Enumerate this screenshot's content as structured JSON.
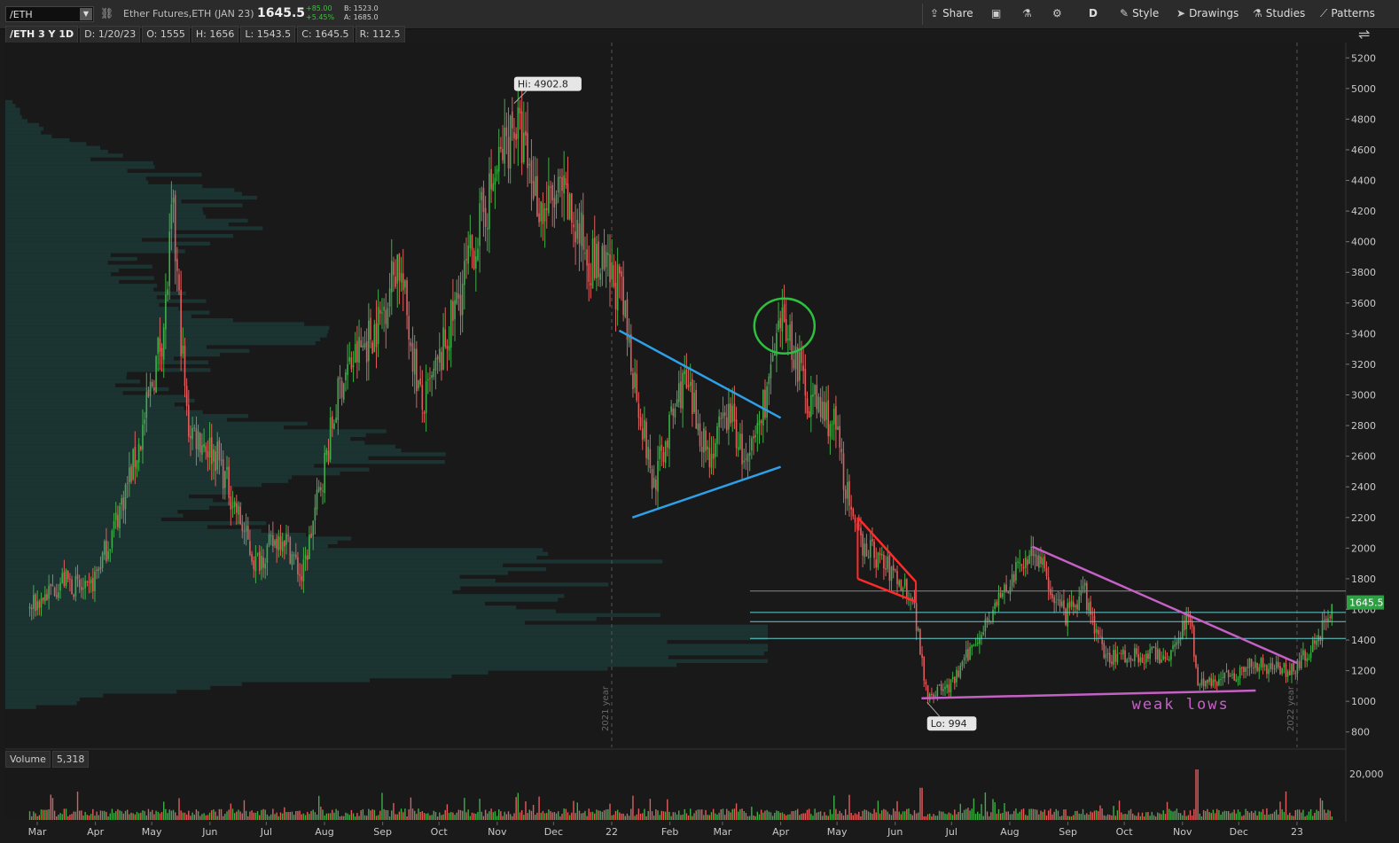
{
  "header": {
    "symbol": "/ETH",
    "description": "Ether Futures,ETH (JAN 23)",
    "last": "1645.5",
    "net_change": "+85.00",
    "pct_change": "+5.45%",
    "bid": "B: 1523.0",
    "ask": "A: 1685.0",
    "timeframe": "D",
    "toolbar": {
      "share": "Share",
      "style": "Style",
      "drawings": "Drawings",
      "studies": "Studies",
      "patterns": "Patterns"
    }
  },
  "info_bar": {
    "label": "/ETH 3 Y 1D",
    "date": "D: 1/20/23",
    "open": "O: 1555",
    "high": "H: 1656",
    "low": "L: 1543.5",
    "close": "C: 1645.5",
    "range": "R: 112.5"
  },
  "volume_panel": {
    "label": "Volume",
    "value": "5,318",
    "tick": "20,000"
  },
  "colors": {
    "up": "#3fae49",
    "down": "#e05d5d",
    "background": "#1a1a1a",
    "blue_trend": "#2ea0e8",
    "red_channel": "#ff2a2a",
    "magenta": "#c561c5",
    "green_circle": "#2fbf3f",
    "cyan_level": "#5fd0d0",
    "volume_profile": "#1c3a37"
  },
  "chart_data": {
    "type": "candlestick",
    "symbol": "/ETH",
    "ylim": [
      700,
      5300
    ],
    "y_ticks": [
      800,
      1000,
      1200,
      1400,
      1600,
      1800,
      2000,
      2200,
      2400,
      2600,
      2800,
      3000,
      3200,
      3400,
      3600,
      3800,
      4000,
      4200,
      4400,
      4600,
      4800,
      5000,
      5200
    ],
    "x_labels": [
      "Mar",
      "Apr",
      "May",
      "Jun",
      "Jul",
      "Aug",
      "Sep",
      "Oct",
      "Nov",
      "Dec",
      "22",
      "Feb",
      "Mar",
      "Apr",
      "May",
      "Jun",
      "Jul",
      "Aug",
      "Sep",
      "Oct",
      "Nov",
      "Dec",
      "23"
    ],
    "year_separators": [
      "2021 year",
      "2022 year"
    ],
    "price_path": [
      {
        "date": "2021-02-25",
        "price": 1600
      },
      {
        "date": "2021-03-15",
        "price": 1800
      },
      {
        "date": "2021-03-28",
        "price": 1700
      },
      {
        "date": "2021-04-10",
        "price": 2100
      },
      {
        "date": "2021-04-25",
        "price": 2700
      },
      {
        "date": "2021-05-08",
        "price": 3500
      },
      {
        "date": "2021-05-12",
        "price": 4200
      },
      {
        "date": "2021-05-20",
        "price": 2800
      },
      {
        "date": "2021-06-05",
        "price": 2600
      },
      {
        "date": "2021-06-25",
        "price": 1900
      },
      {
        "date": "2021-07-10",
        "price": 2100
      },
      {
        "date": "2021-07-20",
        "price": 1800
      },
      {
        "date": "2021-08-10",
        "price": 3100
      },
      {
        "date": "2021-08-31",
        "price": 3500
      },
      {
        "date": "2021-09-09",
        "price": 3900
      },
      {
        "date": "2021-09-22",
        "price": 2900
      },
      {
        "date": "2021-10-01",
        "price": 3200
      },
      {
        "date": "2021-10-25",
        "price": 4200
      },
      {
        "date": "2021-11-10",
        "price": 4800
      },
      {
        "date": "2021-11-25",
        "price": 4200
      },
      {
        "date": "2021-12-05",
        "price": 4300
      },
      {
        "date": "2021-12-20",
        "price": 3900
      },
      {
        "date": "2022-01-05",
        "price": 3700
      },
      {
        "date": "2022-01-23",
        "price": 2400
      },
      {
        "date": "2022-02-08",
        "price": 3100
      },
      {
        "date": "2022-02-22",
        "price": 2600
      },
      {
        "date": "2022-03-05",
        "price": 2900
      },
      {
        "date": "2022-03-14",
        "price": 2500
      },
      {
        "date": "2022-04-03",
        "price": 3500
      },
      {
        "date": "2022-04-15",
        "price": 3000
      },
      {
        "date": "2022-04-30",
        "price": 2800
      },
      {
        "date": "2022-05-10",
        "price": 2100
      },
      {
        "date": "2022-06-10",
        "price": 1700
      },
      {
        "date": "2022-06-18",
        "price": 1050
      },
      {
        "date": "2022-07-01",
        "price": 1100
      },
      {
        "date": "2022-07-18",
        "price": 1500
      },
      {
        "date": "2022-08-13",
        "price": 2000
      },
      {
        "date": "2022-08-30",
        "price": 1550
      },
      {
        "date": "2022-09-10",
        "price": 1700
      },
      {
        "date": "2022-09-20",
        "price": 1300
      },
      {
        "date": "2022-10-10",
        "price": 1300
      },
      {
        "date": "2022-10-25",
        "price": 1300
      },
      {
        "date": "2022-11-05",
        "price": 1600
      },
      {
        "date": "2022-11-09",
        "price": 1100
      },
      {
        "date": "2022-11-22",
        "price": 1150
      },
      {
        "date": "2022-12-10",
        "price": 1250
      },
      {
        "date": "2022-12-28",
        "price": 1200
      },
      {
        "date": "2023-01-10",
        "price": 1350
      },
      {
        "date": "2023-01-20",
        "price": 1645.5
      }
    ],
    "annotations": [
      {
        "type": "label",
        "text": "Hi: 4902.8",
        "date": "2021-11-10",
        "price": 4902.8
      },
      {
        "type": "label",
        "text": "Lo: 994",
        "date": "2022-06-18",
        "price": 994
      },
      {
        "type": "text",
        "text": "weak lows",
        "date": "2022-10-05",
        "price": 950
      }
    ],
    "current_price_tag": "1645.5",
    "horizontal_levels": [
      1720,
      1580,
      1520,
      1410
    ],
    "trendlines": [
      {
        "role": "upper-wedge",
        "color": "blue",
        "from": [
          "2022-01-05",
          3420
        ],
        "to": [
          "2022-04-01",
          2850
        ]
      },
      {
        "role": "lower-wedge",
        "color": "blue",
        "from": [
          "2022-01-12",
          2200
        ],
        "to": [
          "2022-04-01",
          2530
        ]
      },
      {
        "role": "channel-top",
        "color": "red",
        "from": [
          "2022-05-12",
          2200
        ],
        "to": [
          "2022-06-12",
          1780
        ]
      },
      {
        "role": "channel-bottom",
        "color": "red",
        "from": [
          "2022-05-12",
          1800
        ],
        "to": [
          "2022-06-12",
          1650
        ]
      },
      {
        "role": "descending",
        "color": "magenta",
        "from": [
          "2022-08-13",
          2010
        ],
        "to": [
          "2023-01-01",
          1250
        ]
      },
      {
        "role": "lows",
        "color": "magenta",
        "from": [
          "2022-06-15",
          1020
        ],
        "to": [
          "2022-12-10",
          1070
        ]
      }
    ],
    "highlight_circle": {
      "date": "2022-04-03",
      "price": 3450,
      "color": "green"
    },
    "volume_spikes": [
      {
        "date": "2022-06-15",
        "value": 14000
      },
      {
        "date": "2022-11-09",
        "value": 22000
      }
    ],
    "volume_ylim": [
      0,
      22000
    ]
  }
}
